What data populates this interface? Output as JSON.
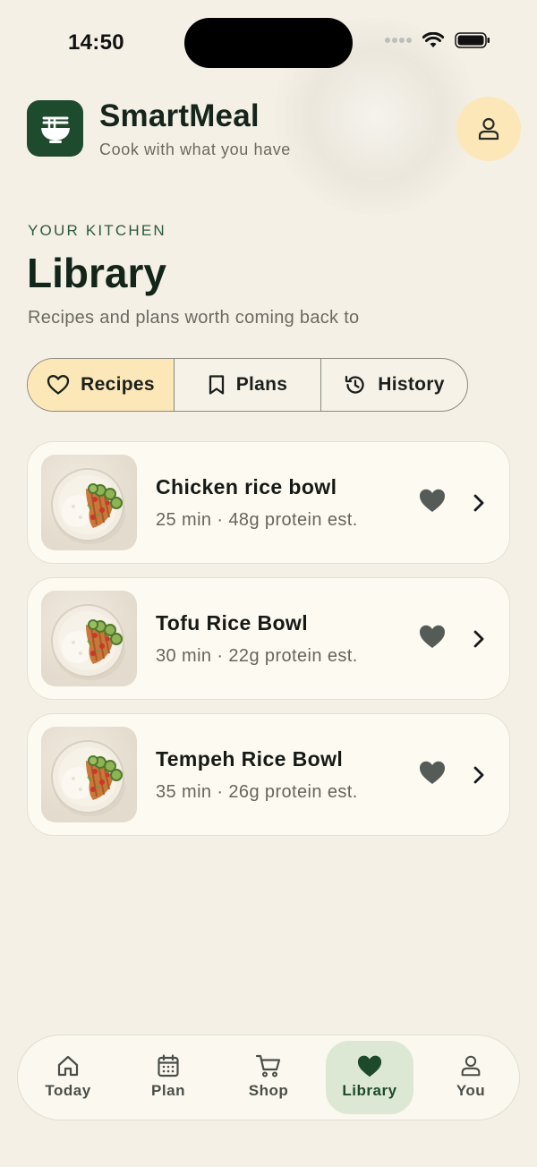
{
  "status_bar": {
    "time": "14:50"
  },
  "app": {
    "name": "SmartMeal",
    "tagline": "Cook with what you have"
  },
  "section": {
    "eyebrow": "YOUR KITCHEN",
    "title": "Library",
    "description": "Recipes and plans worth coming back to"
  },
  "tabs": [
    {
      "label": "Recipes",
      "icon": "heart-outline-icon",
      "active": true
    },
    {
      "label": "Plans",
      "icon": "bookmark-icon",
      "active": false
    },
    {
      "label": "History",
      "icon": "history-icon",
      "active": false
    }
  ],
  "recipes": [
    {
      "title": "Chicken rice bowl",
      "meta": "25 min · 48g protein est.",
      "favorite": true
    },
    {
      "title": "Tofu Rice Bowl",
      "meta": "30 min · 22g protein est.",
      "favorite": true
    },
    {
      "title": "Tempeh Rice Bowl",
      "meta": "35 min · 26g protein est.",
      "favorite": true
    }
  ],
  "bottom_nav": [
    {
      "label": "Today",
      "icon": "home-icon",
      "active": false
    },
    {
      "label": "Plan",
      "icon": "calendar-icon",
      "active": false
    },
    {
      "label": "Shop",
      "icon": "cart-icon",
      "active": false
    },
    {
      "label": "Library",
      "icon": "heart-icon",
      "active": true
    },
    {
      "label": "You",
      "icon": "person-icon",
      "active": false
    }
  ],
  "colors": {
    "background": "#F4F0E6",
    "brand_green": "#1E4A2D",
    "accent_yellow": "#FCE7B8",
    "nav_active": "#DCE8D3",
    "card": "#FDFAF1"
  }
}
